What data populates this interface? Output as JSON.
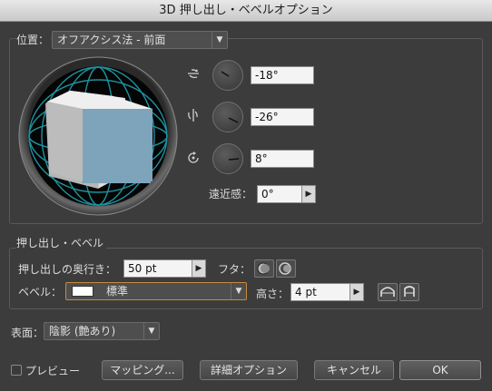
{
  "window": {
    "title": "3D 押し出し・ベベルオプション"
  },
  "position": {
    "label": "位置：",
    "preset": "オフアクシス法 - 前面",
    "rotation_x": "-18°",
    "rotation_y": "-26°",
    "rotation_z": "8°",
    "perspective_label": "遠近感：",
    "perspective": "0°"
  },
  "extrude": {
    "section_label": "押し出し・ベベル",
    "depth_label": "押し出しの奥行き：",
    "depth": "50 pt",
    "cap_label": "フタ：",
    "bevel_label": "ベベル：",
    "bevel": "標準",
    "height_label": "高さ：",
    "height": "4 pt"
  },
  "surface": {
    "label": "表面：",
    "value": "陰影 (艶あり)"
  },
  "footer": {
    "preview_label": "プレビュー",
    "mapping_button": "マッピング...",
    "more_options_button": "詳細オプション",
    "cancel_button": "キャンセル",
    "ok_button": "OK"
  }
}
